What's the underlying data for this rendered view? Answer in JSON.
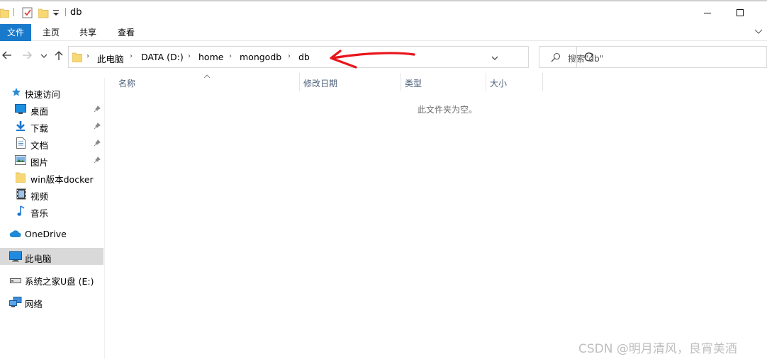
{
  "window": {
    "title": "db",
    "minimize_icon": "minimize-icon",
    "maximize_icon": "maximize-icon"
  },
  "ribbon": {
    "tabs": [
      {
        "label": "文件",
        "active": true
      },
      {
        "label": "主页"
      },
      {
        "label": "共享"
      },
      {
        "label": "查看"
      }
    ]
  },
  "address": {
    "crumbs": [
      "此电脑",
      "DATA (D:)",
      "home",
      "mongodb",
      "db"
    ]
  },
  "search": {
    "placeholder": "搜索\"db\""
  },
  "nav": {
    "items": [
      {
        "label": "快速访问",
        "icon": "star-icon"
      },
      {
        "label": "桌面",
        "icon": "desktop-icon",
        "pinned": true
      },
      {
        "label": "下载",
        "icon": "download-icon",
        "pinned": true
      },
      {
        "label": "文档",
        "icon": "document-icon",
        "pinned": true
      },
      {
        "label": "图片",
        "icon": "picture-icon",
        "pinned": true
      },
      {
        "label": "win版本docker",
        "icon": "folder-icon"
      },
      {
        "label": "视频",
        "icon": "video-icon"
      },
      {
        "label": "音乐",
        "icon": "music-icon"
      },
      {
        "label": "OneDrive",
        "icon": "cloud-icon"
      },
      {
        "label": "此电脑",
        "icon": "computer-icon",
        "selected": true
      },
      {
        "label": "系统之家U盘 (E:)",
        "icon": "drive-icon"
      },
      {
        "label": "网络",
        "icon": "network-icon"
      }
    ]
  },
  "columns": [
    "名称",
    "修改日期",
    "类型",
    "大小"
  ],
  "empty_message": "此文件夹为空。",
  "watermark": "CSDN @明月清风，良宵美酒",
  "colors": {
    "file_tab": "#1979ca",
    "annotation_arrow": "#e8151b",
    "selected_row": "#d9d9d9"
  }
}
